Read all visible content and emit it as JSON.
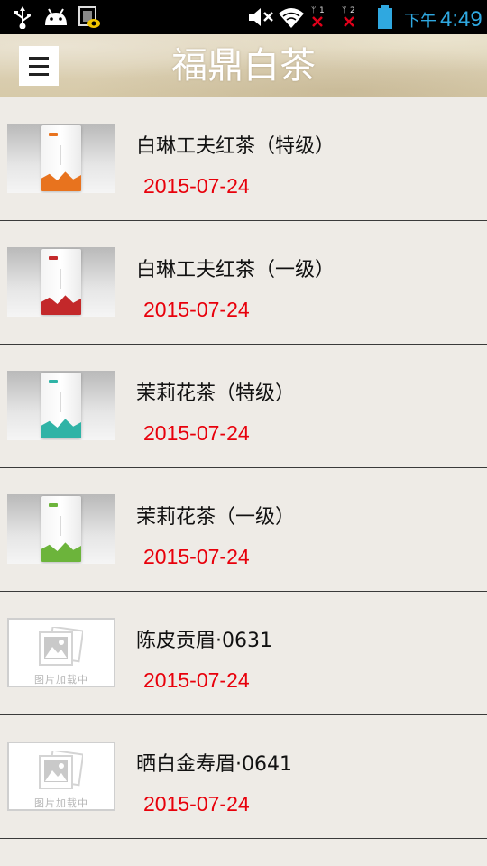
{
  "status_bar": {
    "ampm": "下午",
    "time": "4:49",
    "sim1": "1",
    "sim2": "2",
    "icons": [
      "usb-icon",
      "android-icon",
      "security-shield-icon",
      "mute-icon",
      "wifi-icon",
      "sim-signal-icon",
      "battery-icon"
    ]
  },
  "header": {
    "title": "福鼎白茶",
    "menu_icon": "menu-icon",
    "background_color": "#d9cdb0"
  },
  "colors": {
    "date": "#e8000b",
    "divider": "#3a3a3a",
    "background": "#eeebe6"
  },
  "products": [
    {
      "title": "白琳工夫红茶（特级）",
      "date": "2015-07-24",
      "image": "product-bag",
      "accent": "#e8731e"
    },
    {
      "title": "白琳工夫红茶（一级）",
      "date": "2015-07-24",
      "image": "product-bag",
      "accent": "#c3282a"
    },
    {
      "title": "茉莉花茶（特级）",
      "date": "2015-07-24",
      "image": "product-bag",
      "accent": "#2fb3a6"
    },
    {
      "title": "茉莉花茶（一级）",
      "date": "2015-07-24",
      "image": "product-bag",
      "accent": "#6cb43b"
    },
    {
      "title": "陈皮贡眉·0631",
      "date": "2015-07-24",
      "image": "loading-placeholder",
      "placeholder_text": "图片加载中"
    },
    {
      "title": "晒白金寿眉·0641",
      "date": "2015-07-24",
      "image": "loading-placeholder",
      "placeholder_text": "图片加载中"
    }
  ]
}
